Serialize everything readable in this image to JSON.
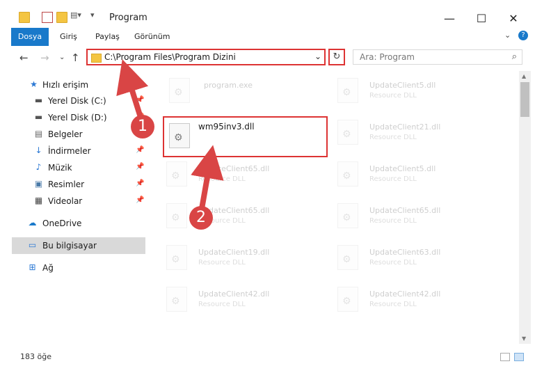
{
  "window": {
    "title": "Program",
    "controls": {
      "minimize": "—",
      "maximize": "☐",
      "close": "✕"
    }
  },
  "ribbon": {
    "tabs": [
      {
        "label": "Dosya",
        "active": true
      },
      {
        "label": "Giriş",
        "active": false
      },
      {
        "label": "Paylaş",
        "active": false
      },
      {
        "label": "Görünüm",
        "active": false
      }
    ],
    "expand_icon": "chevron-down-icon",
    "help_icon": "help-icon"
  },
  "navigation": {
    "address": "C:\\Program Files\\Program Dizini",
    "search_placeholder": "Ara: Program"
  },
  "sidebar": {
    "items": [
      {
        "label": "Hızlı erişim",
        "icon": "star-icon",
        "pinned": false
      },
      {
        "label": "Yerel Disk (C:)",
        "icon": "drive-icon",
        "pinned": true
      },
      {
        "label": "Yerel Disk (D:)",
        "icon": "drive-icon",
        "pinned": true
      },
      {
        "label": "Belgeler",
        "icon": "document-icon",
        "pinned": true
      },
      {
        "label": "İndirmeler",
        "icon": "download-icon",
        "pinned": true
      },
      {
        "label": "Müzik",
        "icon": "music-icon",
        "pinned": true
      },
      {
        "label": "Resimler",
        "icon": "picture-icon",
        "pinned": true
      },
      {
        "label": "Videolar",
        "icon": "video-icon",
        "pinned": true
      },
      {
        "label": "OneDrive",
        "icon": "cloud-icon",
        "pinned": false
      },
      {
        "label": "Bu bilgisayar",
        "icon": "computer-icon",
        "pinned": false,
        "selected": true
      },
      {
        "label": "Ağ",
        "icon": "network-icon",
        "pinned": false
      }
    ]
  },
  "files": {
    "highlighted": {
      "name": "wm95inv3.dll"
    },
    "left_column": [
      {
        "name": "program.exe",
        "type": ""
      },
      {
        "name": "UpdateClient65.dll",
        "type": "Resource DLL"
      },
      {
        "name": "UpdateClient65.dll",
        "type": "Resource DLL"
      },
      {
        "name": "UpdateClient19.dll",
        "type": "Resource DLL"
      },
      {
        "name": "UpdateClient42.dll",
        "type": "Resource DLL"
      }
    ],
    "right_column": [
      {
        "name": "UpdateClient5.dll",
        "type": "Resource DLL"
      },
      {
        "name": "UpdateClient21.dll",
        "type": "Resource DLL"
      },
      {
        "name": "UpdateClient5.dll",
        "type": "Resource DLL"
      },
      {
        "name": "UpdateClient65.dll",
        "type": "Resource DLL"
      },
      {
        "name": "UpdateClient63.dll",
        "type": "Resource DLL"
      },
      {
        "name": "UpdateClient42.dll",
        "type": "Resource DLL"
      }
    ]
  },
  "annotations": {
    "step1": "1",
    "step2": "2",
    "color": "#d94545"
  },
  "status": {
    "item_count": "183 öğe"
  }
}
